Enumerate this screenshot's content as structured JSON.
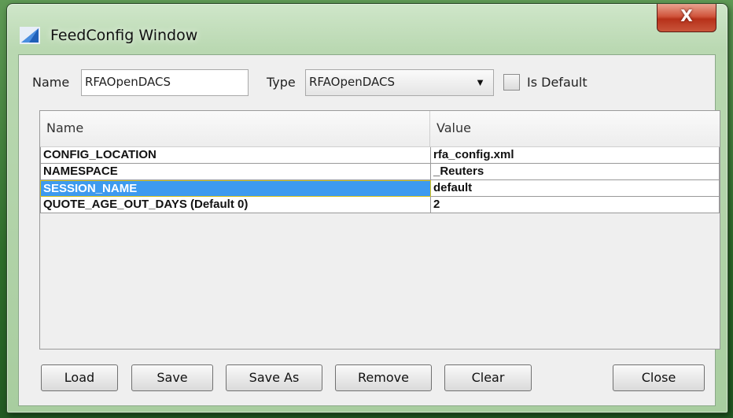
{
  "window": {
    "title": "FeedConfig Window",
    "close_glyph": "X"
  },
  "form": {
    "name_label": "Name",
    "name_value": "RFAOpenDACS",
    "type_label": "Type",
    "type_value": "RFAOpenDACS",
    "is_default_label": "Is Default",
    "is_default_checked": false
  },
  "table": {
    "headers": [
      "Name",
      "Value"
    ],
    "rows": [
      {
        "name": "CONFIG_LOCATION",
        "value": "rfa_config.xml"
      },
      {
        "name": "NAMESPACE",
        "value": "_Reuters"
      },
      {
        "name": "SESSION_NAME",
        "value": "default"
      },
      {
        "name": "QUOTE_AGE_OUT_DAYS (Default 0)",
        "value": "2"
      }
    ],
    "selected_row": 2
  },
  "buttons": {
    "load": "Load",
    "save": "Save",
    "save_as": "Save As",
    "remove": "Remove",
    "clear": "Clear",
    "close": "Close"
  },
  "colors": {
    "selection": "#3d9aef",
    "close_button": "#c9553a",
    "window_frame": "#b9d8b1"
  },
  "icons": [
    "app-icon",
    "close-icon",
    "dropdown-arrow-icon"
  ]
}
